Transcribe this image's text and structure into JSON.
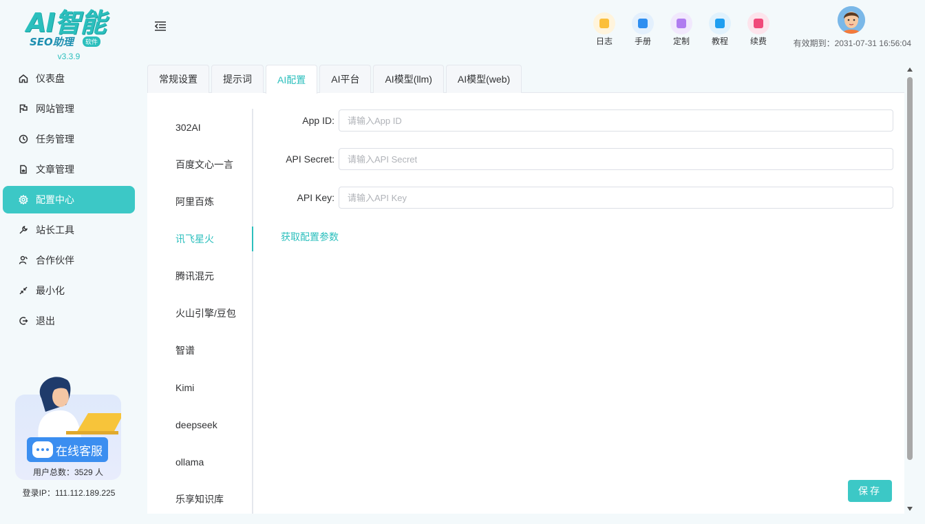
{
  "app": {
    "logo_text": "AI智能",
    "logo_sub": "SEO助理",
    "logo_badge": "软件",
    "version": "v3.3.9"
  },
  "sidebar": {
    "items": [
      {
        "label": "仪表盘",
        "icon": "home-icon"
      },
      {
        "label": "网站管理",
        "icon": "flag-icon"
      },
      {
        "label": "任务管理",
        "icon": "clock-icon"
      },
      {
        "label": "文章管理",
        "icon": "document-icon"
      },
      {
        "label": "配置中心",
        "icon": "gear-icon",
        "active": true
      },
      {
        "label": "站长工具",
        "icon": "wrench-icon"
      },
      {
        "label": "合作伙伴",
        "icon": "partner-icon"
      },
      {
        "label": "最小化",
        "icon": "minimize-icon"
      },
      {
        "label": "退出",
        "icon": "logout-icon"
      }
    ],
    "promo_button": "在线客服",
    "total_users": "用户总数：3529 人",
    "login_ip": "登录IP：111.112.189.225"
  },
  "header": {
    "tools": [
      {
        "label": "日志",
        "icon": "log-icon",
        "color": "#fbbf3b",
        "bg": "#fff4dc"
      },
      {
        "label": "手册",
        "icon": "manual-icon",
        "color": "#2e8ef0",
        "bg": "#e3f0fd"
      },
      {
        "label": "定制",
        "icon": "custom-icon",
        "color": "#b07cf0",
        "bg": "#f1e8fd"
      },
      {
        "label": "教程",
        "icon": "tutorial-icon",
        "color": "#1e9ef0",
        "bg": "#e1f2fd"
      },
      {
        "label": "续费",
        "icon": "renew-icon",
        "color": "#f04a7a",
        "bg": "#fde4ec"
      }
    ],
    "expire": "有效期到：2031-07-31 16:56:04"
  },
  "tabs": [
    {
      "label": "常规设置"
    },
    {
      "label": "提示词"
    },
    {
      "label": "AI配置",
      "active": true
    },
    {
      "label": "AI平台"
    },
    {
      "label": "AI模型(llm)"
    },
    {
      "label": "AI模型(web)"
    }
  ],
  "providers": [
    {
      "label": "302AI"
    },
    {
      "label": "百度文心一言"
    },
    {
      "label": "阿里百炼"
    },
    {
      "label": "讯飞星火",
      "active": true
    },
    {
      "label": "腾讯混元"
    },
    {
      "label": "火山引擎/豆包"
    },
    {
      "label": "智谱"
    },
    {
      "label": "Kimi"
    },
    {
      "label": "deepseek"
    },
    {
      "label": "ollama"
    },
    {
      "label": "乐享知识库"
    }
  ],
  "form": {
    "app_id_label": "App ID:",
    "app_id_placeholder": "请输入App ID",
    "app_id_value": "",
    "api_secret_label": "API Secret:",
    "api_secret_placeholder": "请输入API Secret",
    "api_secret_value": "",
    "api_key_label": "API Key:",
    "api_key_placeholder": "请输入API Key",
    "api_key_value": "",
    "get_params_link": "获取配置参数",
    "save_label": "保存"
  },
  "colors": {
    "accent": "#3cc8c6",
    "accent_text": "#2bbfbd"
  }
}
